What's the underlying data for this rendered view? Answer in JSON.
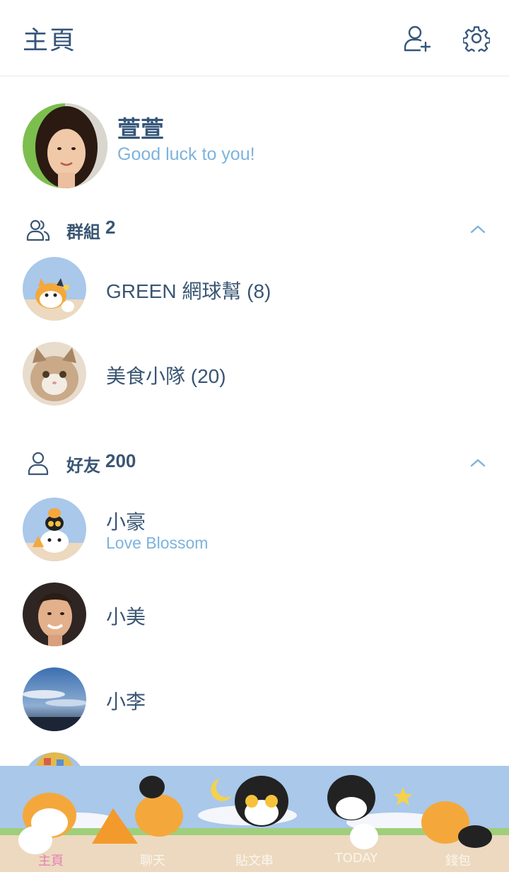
{
  "header": {
    "title": "主頁",
    "add_friend_icon": "add-friend-icon",
    "settings_icon": "gear-icon"
  },
  "profile": {
    "name": "萱萱",
    "status": "Good luck to you!"
  },
  "groups": {
    "label": "群組",
    "count": "2",
    "items": [
      {
        "name": "GREEN 網球幫 (8)"
      },
      {
        "name": "美食小隊 (20)"
      }
    ]
  },
  "friends": {
    "label": "好友",
    "count": "200",
    "items": [
      {
        "name": "小豪",
        "status": "Love Blossom"
      },
      {
        "name": "小美"
      },
      {
        "name": "小李"
      }
    ]
  },
  "tabs": [
    {
      "label": "主頁",
      "active": true
    },
    {
      "label": "聊天"
    },
    {
      "label": "貼文串"
    },
    {
      "label": "TODAY"
    },
    {
      "label": "錢包"
    }
  ],
  "colors": {
    "accent": "#35567a",
    "status_blue": "#7cb3de",
    "active_tab": "#e57fb7",
    "tabbar_sky": "#a9c8ea",
    "tabbar_ground": "#ecd9bf"
  }
}
